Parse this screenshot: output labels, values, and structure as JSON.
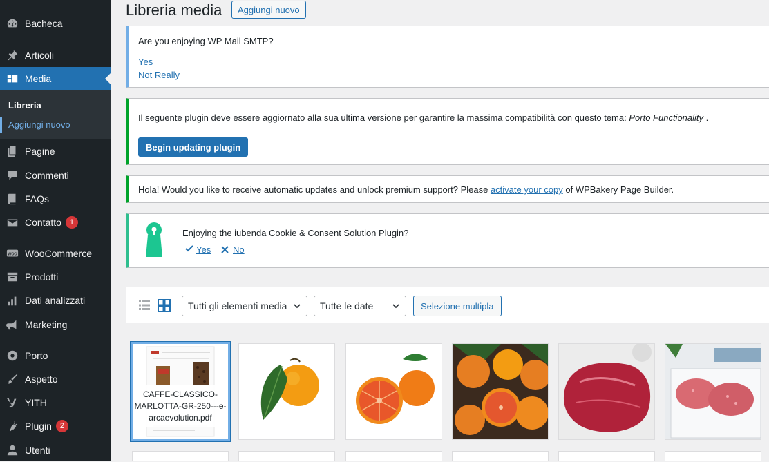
{
  "sidebar": {
    "items": [
      {
        "label": "Bacheca",
        "icon": "dashboard-icon"
      },
      {
        "label": "Articoli",
        "icon": "pin-icon"
      },
      {
        "label": "Media",
        "icon": "media-icon"
      },
      {
        "label": "Pagine",
        "icon": "pages-icon"
      },
      {
        "label": "Commenti",
        "icon": "comments-icon"
      },
      {
        "label": "FAQs",
        "icon": "book-icon"
      },
      {
        "label": "Contatto",
        "icon": "mail-icon",
        "badge": "1"
      },
      {
        "label": "WooCommerce",
        "icon": "woo-icon"
      },
      {
        "label": "Prodotti",
        "icon": "archive-icon"
      },
      {
        "label": "Dati analizzati",
        "icon": "chart-icon"
      },
      {
        "label": "Marketing",
        "icon": "megaphone-icon"
      },
      {
        "label": "Porto",
        "icon": "circle-icon"
      },
      {
        "label": "Aspetto",
        "icon": "brush-icon"
      },
      {
        "label": "YITH",
        "icon": "yith-icon"
      },
      {
        "label": "Plugin",
        "icon": "plugin-icon",
        "badge": "2"
      },
      {
        "label": "Utenti",
        "icon": "user-icon"
      }
    ],
    "submenu": [
      "Libreria",
      "Aggiungi nuovo"
    ]
  },
  "header": {
    "title": "Libreria media",
    "add_new": "Aggiungi nuovo"
  },
  "notices": {
    "smtp": {
      "question": "Are you enjoying WP Mail SMTP?",
      "yes": "Yes",
      "no": "Not Really"
    },
    "plugin_update": {
      "text": "Il seguente plugin deve essere aggiornato alla sua ultima versione per garantire la massima compatibilità con questo tema:",
      "plugin": "Porto Functionality",
      "period": ".",
      "button": "Begin updating plugin"
    },
    "wpbakery": {
      "before": "Hola! Would you like to receive automatic updates and unlock premium support? Please",
      "link": "activate your copy",
      "after": "of WPBakery Page Builder."
    },
    "iubenda": {
      "question": "Enjoying the iubenda Cookie & Consent Solution Plugin?",
      "yes": "Yes",
      "no": "No"
    }
  },
  "toolbar": {
    "filter_type": "Tutti gli elementi media",
    "filter_date": "Tutte le date",
    "bulk_select": "Selezione multipla"
  },
  "media": {
    "pdf_title": "CAFFE-CLASSICO-MARLOTTA-GR-250---e-arcaevolution.pdf"
  },
  "colors": {
    "sidebar_bg": "#1d2327",
    "accent": "#2271b1",
    "badge": "#d63638",
    "success": "#00a32a"
  }
}
